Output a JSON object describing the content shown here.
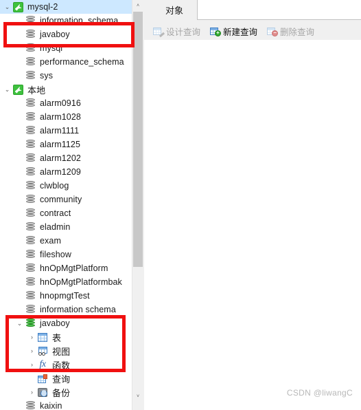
{
  "app": {
    "watermark": "CSDN @liwangC"
  },
  "tree": {
    "nodes": [
      {
        "label": "mysql-2",
        "icon": "connection-icon",
        "indent": 0,
        "twisty": "expanded",
        "selected": true
      },
      {
        "label": "information_schema",
        "icon": "database-icon",
        "indent": 1,
        "twisty": "none",
        "selected": false
      },
      {
        "label": "javaboy",
        "icon": "database-icon",
        "indent": 1,
        "twisty": "none",
        "selected": false
      },
      {
        "label": "mysql",
        "icon": "database-icon",
        "indent": 1,
        "twisty": "none",
        "selected": false
      },
      {
        "label": "performance_schema",
        "icon": "database-icon",
        "indent": 1,
        "twisty": "none",
        "selected": false
      },
      {
        "label": "sys",
        "icon": "database-icon",
        "indent": 1,
        "twisty": "none",
        "selected": false
      },
      {
        "label": "本地",
        "icon": "connection-icon",
        "indent": 0,
        "twisty": "expanded",
        "selected": false
      },
      {
        "label": "alarm0916",
        "icon": "database-icon",
        "indent": 1,
        "twisty": "none",
        "selected": false
      },
      {
        "label": "alarm1028",
        "icon": "database-icon",
        "indent": 1,
        "twisty": "none",
        "selected": false
      },
      {
        "label": "alarm1111",
        "icon": "database-icon",
        "indent": 1,
        "twisty": "none",
        "selected": false
      },
      {
        "label": "alarm1125",
        "icon": "database-icon",
        "indent": 1,
        "twisty": "none",
        "selected": false
      },
      {
        "label": "alarm1202",
        "icon": "database-icon",
        "indent": 1,
        "twisty": "none",
        "selected": false
      },
      {
        "label": "alarm1209",
        "icon": "database-icon",
        "indent": 1,
        "twisty": "none",
        "selected": false
      },
      {
        "label": "clwblog",
        "icon": "database-icon",
        "indent": 1,
        "twisty": "none",
        "selected": false
      },
      {
        "label": "community",
        "icon": "database-icon",
        "indent": 1,
        "twisty": "none",
        "selected": false
      },
      {
        "label": "contract",
        "icon": "database-icon",
        "indent": 1,
        "twisty": "none",
        "selected": false
      },
      {
        "label": "eladmin",
        "icon": "database-icon",
        "indent": 1,
        "twisty": "none",
        "selected": false
      },
      {
        "label": "exam",
        "icon": "database-icon",
        "indent": 1,
        "twisty": "none",
        "selected": false
      },
      {
        "label": "fileshow",
        "icon": "database-icon",
        "indent": 1,
        "twisty": "none",
        "selected": false
      },
      {
        "label": "hnOpMgtPlatform",
        "icon": "database-icon",
        "indent": 1,
        "twisty": "none",
        "selected": false
      },
      {
        "label": "hnOpMgtPlatformbak",
        "icon": "database-icon",
        "indent": 1,
        "twisty": "none",
        "selected": false
      },
      {
        "label": "hnopmgtTest",
        "icon": "database-icon",
        "indent": 1,
        "twisty": "none",
        "selected": false
      },
      {
        "label": "information schema",
        "icon": "database-icon",
        "indent": 1,
        "twisty": "none",
        "selected": false
      },
      {
        "label": "javaboy",
        "icon": "database-active-icon",
        "indent": 1,
        "twisty": "expanded",
        "selected": false
      },
      {
        "label": "表",
        "icon": "table-icon",
        "indent": 2,
        "twisty": "collapsed",
        "selected": false
      },
      {
        "label": "视图",
        "icon": "view-icon",
        "indent": 2,
        "twisty": "collapsed",
        "selected": false
      },
      {
        "label": "函数",
        "icon": "function-icon",
        "indent": 2,
        "twisty": "collapsed",
        "selected": false
      },
      {
        "label": "查询",
        "icon": "query-icon",
        "indent": 2,
        "twisty": "none",
        "selected": false
      },
      {
        "label": "备份",
        "icon": "backup-icon",
        "indent": 2,
        "twisty": "collapsed",
        "selected": false
      },
      {
        "label": "kaixin",
        "icon": "database-icon",
        "indent": 1,
        "twisty": "none",
        "selected": false
      }
    ],
    "scrollbar": {
      "up_arrow": "˄",
      "down_arrow": "˅"
    }
  },
  "right": {
    "tabs": [
      {
        "label": "对象",
        "active": true
      }
    ],
    "toolbar": [
      {
        "label": "设计查询",
        "icon": "design-query-icon",
        "enabled": false
      },
      {
        "label": "新建查询",
        "icon": "new-query-icon",
        "enabled": true
      },
      {
        "label": "删除查询",
        "icon": "delete-query-icon",
        "enabled": false
      }
    ]
  },
  "annotations": {
    "box1_target": "javaboy",
    "box2_target": "javaboy-expanded"
  },
  "colors": {
    "accent_red": "#f01010",
    "selection_blue": "#cde8ff",
    "db_green": "#3ec13e",
    "grid_blue": "#3f7ec4"
  }
}
